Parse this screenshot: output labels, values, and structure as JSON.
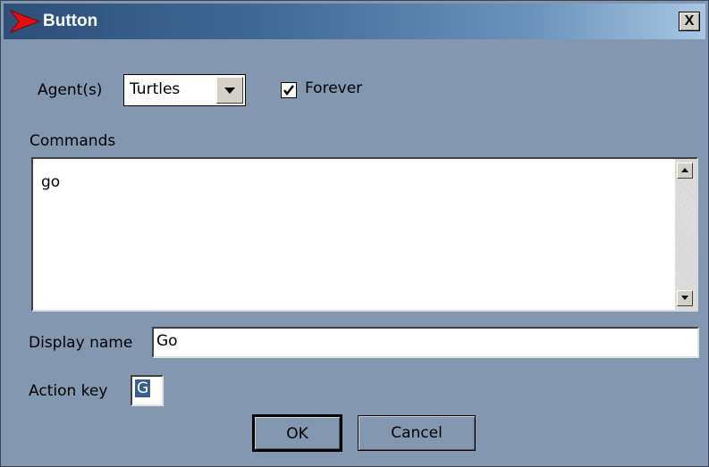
{
  "window": {
    "title": "Button",
    "app_icon": "red-arrow-icon",
    "close_label": "X",
    "background": "#8497b0",
    "title_gradient": [
      "#2d4f78",
      "#a7c7e3"
    ]
  },
  "agents": {
    "label": "Agent(s)",
    "selected": "Turtles",
    "arrow_icon": "chevron-down-icon"
  },
  "forever": {
    "label": "Forever",
    "checked": true
  },
  "commands": {
    "label": "Commands",
    "value": "go"
  },
  "display_name": {
    "label": "Display name",
    "value": "Go"
  },
  "action_key": {
    "label": "Action key",
    "value": "G"
  },
  "buttons": {
    "ok": "OK",
    "cancel": "Cancel"
  }
}
